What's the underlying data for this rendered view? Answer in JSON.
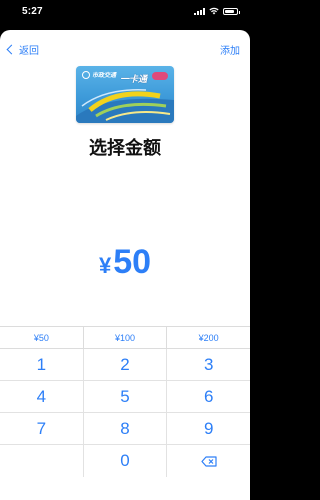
{
  "status_bar": {
    "time": "5:27"
  },
  "nav": {
    "back_label": "返回",
    "add_label": "添加"
  },
  "card": {
    "brand": "市政交通",
    "title": "一卡通"
  },
  "page_title": "选择金额",
  "amount": {
    "currency": "¥",
    "value": "50"
  },
  "presets": [
    "¥50",
    "¥100",
    "¥200"
  ],
  "keys": [
    [
      "1",
      "2",
      "3"
    ],
    [
      "4",
      "5",
      "6"
    ],
    [
      "7",
      "8",
      "9"
    ],
    [
      "",
      "0",
      "⌫"
    ]
  ],
  "colors": {
    "accent": "#2d7ff7",
    "card": "#3d9ad9"
  }
}
